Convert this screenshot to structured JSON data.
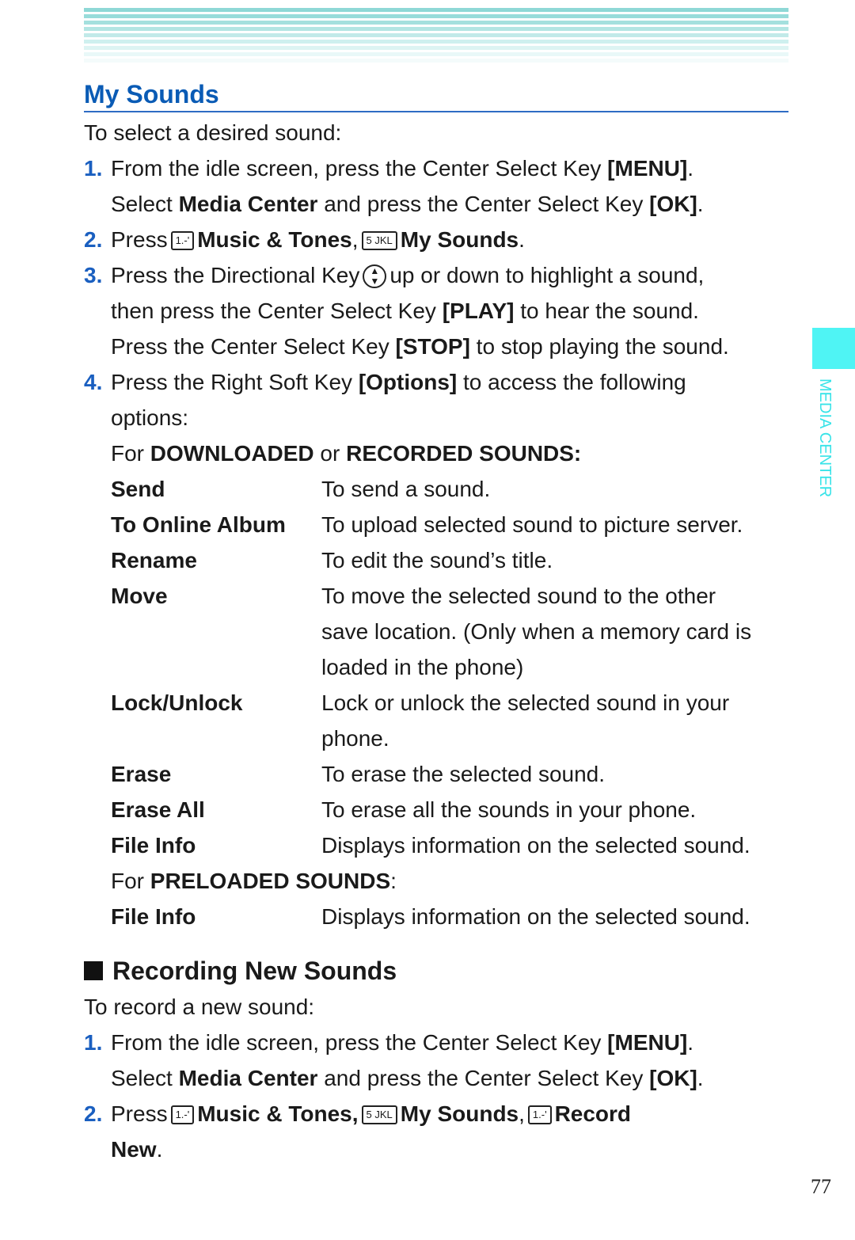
{
  "header": {
    "stripe_color": "#8fd8d6"
  },
  "section_title": "My Sounds",
  "intro": "To select a desired sound:",
  "steps": [
    {
      "num": "1.",
      "parts": [
        "From the idle screen, press the Center Select Key ",
        "[MENU]",
        ".",
        "Select ",
        "Media Center",
        " and press the Center Select Key ",
        "[OK]",
        "."
      ]
    },
    {
      "num": "2.",
      "press": "Press",
      "key1": "1.-'",
      "item1": "Music & Tones",
      "key2": "5 JKL",
      "item2": "My Sounds"
    },
    {
      "num": "3.",
      "line1a": "Press the Directional Key",
      "line1b": "up or down to highlight a sound,",
      "line2a": "then press the Center Select Key ",
      "line2b": "[PLAY]",
      "line2c": " to hear the sound.",
      "line3a": "Press the Center Select Key ",
      "line3b": "[STOP]",
      "line3c": " to stop playing the sound."
    },
    {
      "num": "4.",
      "line1a": "Press the Right Soft Key ",
      "line1b": "[Options]",
      "line1c": " to access the following",
      "line2": "options:"
    }
  ],
  "downloaded_header": {
    "for": "For ",
    "a": "DOWNLOADED",
    "or": " or ",
    "b": "RECORDED SOUNDS:"
  },
  "options": [
    {
      "key": "Send",
      "lines": [
        "To send a sound."
      ]
    },
    {
      "key": "To Online Album",
      "lines": [
        "To upload selected sound to picture server."
      ]
    },
    {
      "key": "Rename",
      "lines": [
        "To edit the sound’s title."
      ]
    },
    {
      "key": "Move",
      "lines": [
        "To move the selected sound to the other",
        "save location. (Only when a memory card is",
        "loaded in the phone)"
      ]
    },
    {
      "key": "Lock/Unlock",
      "lines": [
        "Lock or unlock the selected sound in your",
        "phone."
      ]
    },
    {
      "key": "Erase",
      "lines": [
        "To erase the selected sound."
      ]
    },
    {
      "key": "Erase All",
      "lines": [
        "To erase all the sounds in your phone."
      ]
    },
    {
      "key": "File Info",
      "lines": [
        "Displays information on the selected sound."
      ]
    }
  ],
  "preloaded_header": {
    "for": "For ",
    "a": "PRELOADED SOUNDS",
    "colon": ":"
  },
  "preloaded_options": [
    {
      "key": "File Info",
      "lines": [
        "Displays information on the selected sound."
      ]
    }
  ],
  "recording": {
    "title": "Recording New Sounds",
    "intro": "To record a new sound:",
    "step1": {
      "num": "1.",
      "a": "From the idle screen, press the Center Select Key ",
      "b": "[MENU]",
      "c": ".",
      "d": "Select ",
      "e": "Media Center",
      "f": " and press the Center Select Key ",
      "g": "[OK]",
      "h": "."
    },
    "step2": {
      "num": "2.",
      "press": "Press",
      "key1": "1.-'",
      "item1": "Music & Tones,",
      "key2": "5 JKL",
      "item2": "My Sounds",
      "key3": "1.-'",
      "item3a": "Record",
      "item3b": "New"
    }
  },
  "sidebar_label": "MEDIA CENTER",
  "page_number": "77"
}
